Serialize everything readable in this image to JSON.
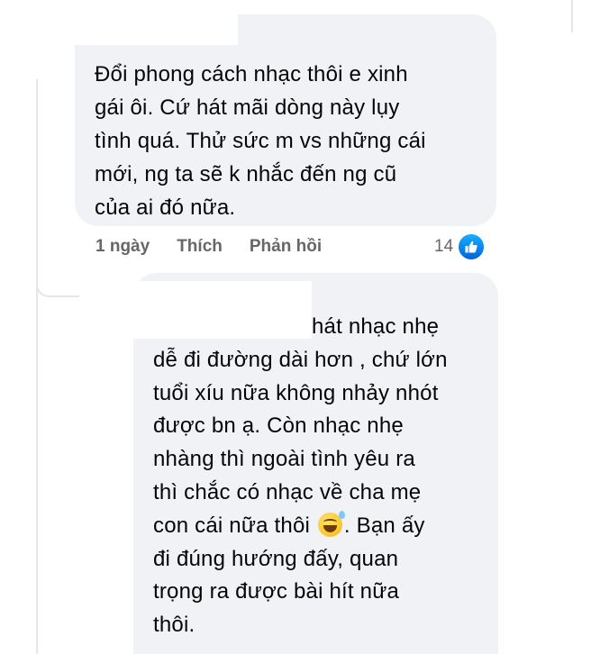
{
  "comments": [
    {
      "text": "Đổi phong cách nhạc thôi e xinh\ngái ôi. Cứ hát mãi dòng này lụy\ntình quá. Thử sức m vs những cái\nmới, ng ta sẽ k nhắc đến ng cũ\ncủa ai đó nữa.",
      "meta": {
        "time": "1 ngày",
        "like_label": "Thích",
        "reply_label": "Phản hồi",
        "reaction_count": "14",
        "reaction_icon": "like-icon"
      }
    }
  ],
  "reply": {
    "text_before_emoji": "hát nhạc nhẹ\ndễ đi đường dài hơn , chứ lớn\ntuổi xíu nữa không nhảy nhót\nđược bn ạ. Còn nhạc nhẹ\nnhàng thì ngoài tình yêu ra\nthì chắc có nhạc về cha mẹ\ncon cái nữa thôi ",
    "emoji": "grinning-sweat-emoji",
    "text_after_emoji": ". Bạn ấy\nđi đúng hướng đấy, quan\ntrọng ra được bài hít nữa\nthôi."
  },
  "colors": {
    "bubble_bg": "#f0f2f5",
    "meta_text": "#65676b",
    "like_blue": "#0866ff"
  }
}
